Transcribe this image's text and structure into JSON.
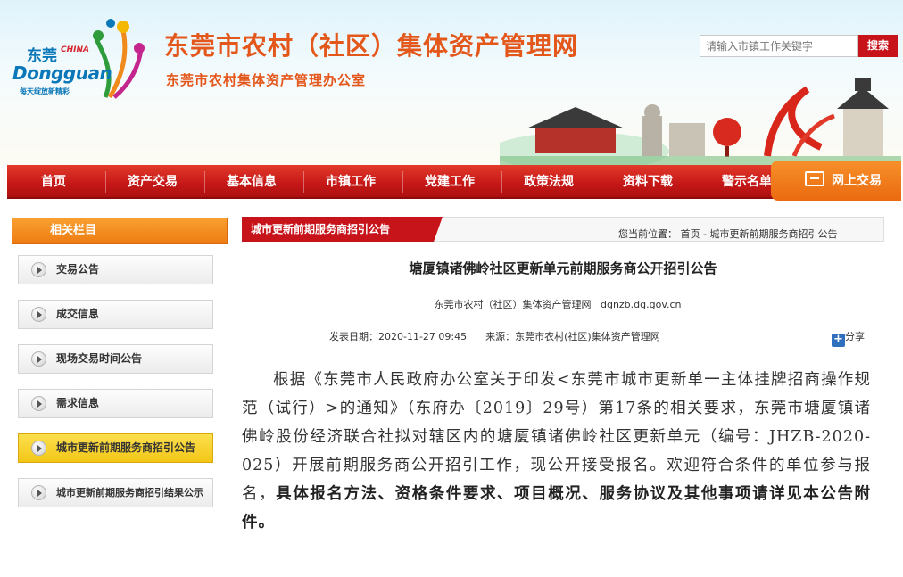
{
  "logo": {
    "cn": "东莞",
    "china": "CHINA",
    "en": "Dongguan",
    "slogan": "每天绽放新精彩"
  },
  "header": {
    "title": "东莞市农村（社区）集体资产管理网",
    "subtitle": "东莞市农村集体资产管理办公室",
    "search_placeholder": "请输入市镇工作关键字",
    "search_button": "搜索"
  },
  "nav": {
    "items": [
      "首页",
      "资产交易",
      "基本信息",
      "市镇工作",
      "党建工作",
      "政策法规",
      "资料下载",
      "警示名单"
    ],
    "online_trade": "网上交易"
  },
  "sidebar": {
    "heading": "相关栏目",
    "items": [
      {
        "label": "交易公告"
      },
      {
        "label": "成交信息"
      },
      {
        "label": "现场交易时间公告"
      },
      {
        "label": "需求信息"
      },
      {
        "label": "城市更新前期服务商招引公告"
      },
      {
        "label": "城市更新前期服务商招引结果公示"
      }
    ],
    "active_index": 4
  },
  "main": {
    "tab": "城市更新前期服务商招引公告",
    "breadcrumb_prefix": "您当前位置：",
    "breadcrumb_home": "首页",
    "breadcrumb_sep": " - ",
    "breadcrumb_current": "城市更新前期服务商招引公告",
    "article": {
      "title": "塘厦镇诸佛岭社区更新单元前期服务商公开招引公告",
      "source_line": "东莞市农村（社区）集体资产管理网   dgnzb.dg.gov.cn",
      "date_label": "发表日期：",
      "date": "2020-11-27 09:45",
      "source_label": "来源：",
      "source": "东莞市农村(社区)集体资产管理网",
      "share": "分享",
      "body_normal": "根据《东莞市人民政府办公室关于印发<东莞市城市更新单一主体挂牌招商操作规范（试行）>的通知》（东府办〔2019〕29号）第17条的相关要求，东莞市塘厦镇诸佛岭股份经济联合社拟对辖区内的塘厦镇诸佛岭社区更新单元（编号：JHZB-2020-025）开展前期服务商公开招引工作，现公开接受报名。欢迎符合条件的单位参与报名，",
      "body_bold": "具体报名方法、资格条件要求、项目概况、服务协议及其他事项请详见本公告附件。"
    }
  },
  "colors": {
    "brand_red": "#c7141b",
    "title_orange": "#e4571b",
    "active_yellow": "#f3c617",
    "nav_orange": "#ee7c12"
  }
}
